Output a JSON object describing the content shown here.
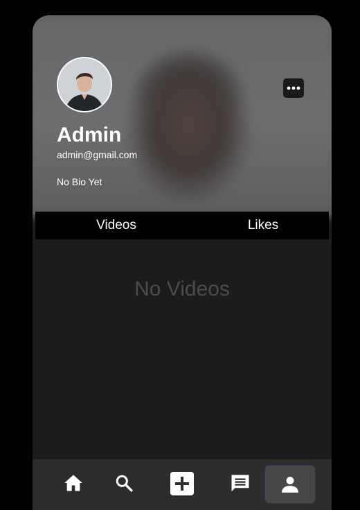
{
  "profile": {
    "name": "Admin",
    "email": "admin@gmail.com",
    "bio": "No Bio Yet"
  },
  "tabs": {
    "videos": "Videos",
    "likes": "Likes"
  },
  "content": {
    "empty_message": "No Videos"
  },
  "navbar": {
    "items": [
      {
        "icon": "home-icon"
      },
      {
        "icon": "search-icon"
      },
      {
        "icon": "add-icon"
      },
      {
        "icon": "chat-icon"
      },
      {
        "icon": "profile-icon",
        "active": true
      }
    ]
  },
  "colors": {
    "background": "#000000",
    "content": "#1c1c1c",
    "navbar": "#2c2c2c",
    "active_nav": "#474747",
    "empty_text": "#4b4b4b"
  }
}
